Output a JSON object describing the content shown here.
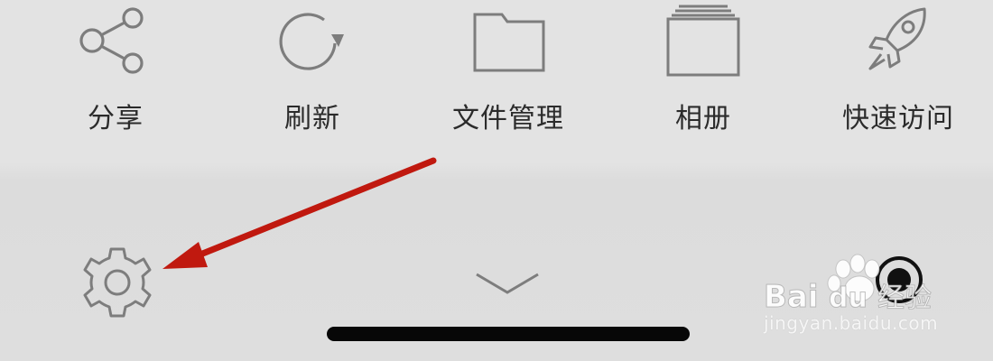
{
  "menu": {
    "items": [
      {
        "label": "分享",
        "icon": "share-icon"
      },
      {
        "label": "刷新",
        "icon": "refresh-icon"
      },
      {
        "label": "文件管理",
        "icon": "folder-icon"
      },
      {
        "label": "相册",
        "icon": "album-icon"
      },
      {
        "label": "快速访问",
        "icon": "rocket-icon"
      }
    ]
  },
  "bottom_bar": {
    "settings_icon": "gear-icon",
    "collapse_icon": "chevron-down-icon",
    "record_icon": "record-icon"
  },
  "annotation": {
    "arrow_color": "#c0190f",
    "target": "gear-icon"
  },
  "watermark": {
    "brand": "Bai度经验",
    "url": "jingyan.baidu.com"
  },
  "colors": {
    "background": "#e2e2e2",
    "icon_stroke": "#7a7a7a",
    "label_text": "#2b2b2b",
    "home_indicator": "#070707"
  }
}
